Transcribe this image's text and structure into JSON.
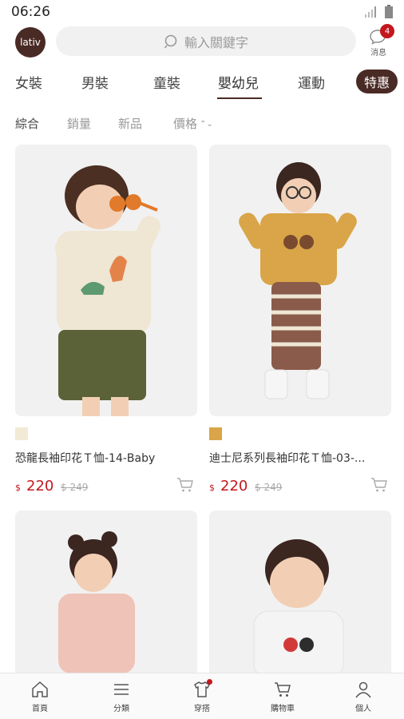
{
  "status_bar": {
    "time": "06:26"
  },
  "header": {
    "logo_text": "lativ",
    "search_placeholder": "輸入關鍵字",
    "messages_label": "消息",
    "messages_count": "4"
  },
  "category_tabs": [
    {
      "label": "女裝"
    },
    {
      "label": "男裝"
    },
    {
      "label": "童裝"
    },
    {
      "label": "嬰幼兒"
    },
    {
      "label": "運動"
    }
  ],
  "special_tab": "特惠",
  "active_category": "嬰幼兒",
  "sort_options": [
    "綜合",
    "銷量",
    "新品",
    "價格"
  ],
  "products": [
    {
      "title": "恐龍長袖印花Ｔ恤-14-Baby",
      "swatch_color": "#f3ead6",
      "currency": "$",
      "price": "220",
      "old_price": "$ 249",
      "shirt_color": "#efe6d3",
      "pants_color": "#5b6238"
    },
    {
      "title": "迪士尼系列長袖印花Ｔ恤-03-...",
      "swatch_color": "#d9a548",
      "currency": "$",
      "price": "220",
      "old_price": "$ 249",
      "shirt_color": "#d9a548",
      "pants_color": "#8a5a4a"
    },
    {
      "title": "",
      "shirt_color": "#efc3b8"
    },
    {
      "title": "",
      "shirt_color": "#f4f4f4"
    }
  ],
  "bottom_nav": [
    {
      "label": "首頁",
      "icon": "home-icon"
    },
    {
      "label": "分類",
      "icon": "menu-icon"
    },
    {
      "label": "穿搭",
      "icon": "shirt-icon"
    },
    {
      "label": "購物車",
      "icon": "cart-icon"
    },
    {
      "label": "個人",
      "icon": "person-icon"
    }
  ],
  "colors": {
    "brand": "#4a2a25",
    "price": "#c4171e",
    "badge": "#c4171e"
  }
}
